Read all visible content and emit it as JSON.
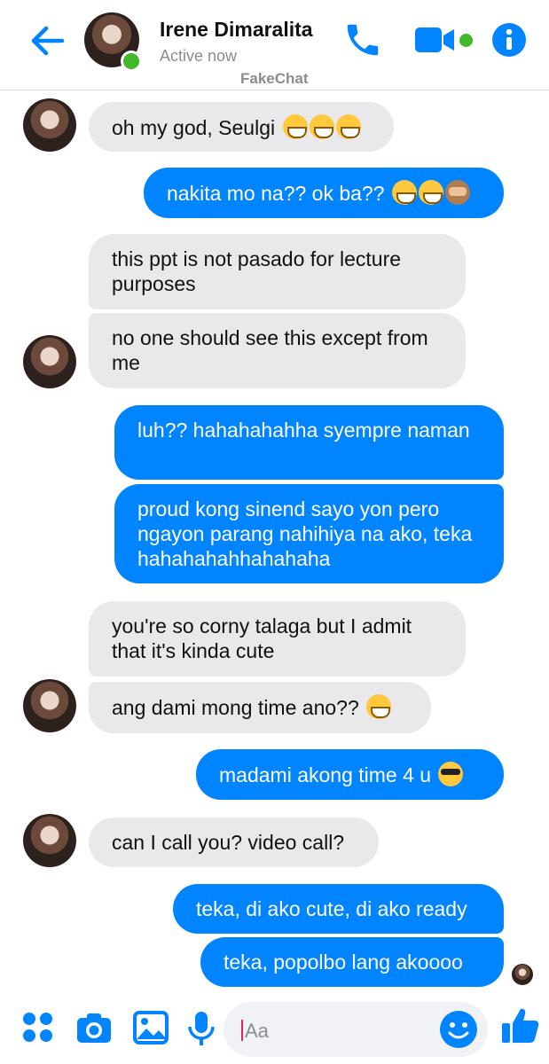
{
  "header": {
    "contact_name": "Irene Dimaralita",
    "status": "Active now",
    "watermark": "FakeChat"
  },
  "colors": {
    "accent": "#0084ff",
    "incoming_bubble": "#e9e9eb",
    "online": "#42b72a"
  },
  "messages": [
    {
      "side": "in",
      "text": "oh my god, Seulgi ",
      "emojis": [
        "grin",
        "grin",
        "grin"
      ]
    },
    {
      "side": "out",
      "text": "nakita mo na?? ok ba?? ",
      "emojis": [
        "grin",
        "grin",
        "see-no-evil-monkey"
      ]
    },
    {
      "side": "in",
      "text": "this ppt is not pasado for lecture purposes"
    },
    {
      "side": "in",
      "text": "no one should see this except from me"
    },
    {
      "side": "out",
      "text": "luh?? hahahahahha syempre naman"
    },
    {
      "side": "out",
      "text": "proud kong sinend sayo yon pero ngayon parang nahihiya na ako, teka hahahahahhahahaha"
    },
    {
      "side": "in",
      "text": "you're so corny talaga but I admit that it's kinda cute"
    },
    {
      "side": "in",
      "text": "ang dami mong time ano?? ",
      "emojis": [
        "grin"
      ]
    },
    {
      "side": "out",
      "text": "madami akong time 4 u ",
      "emojis": [
        "sunglasses"
      ]
    },
    {
      "side": "in",
      "text": "can I call you? video call?"
    },
    {
      "side": "out",
      "text": "teka, di ako cute, di ako ready"
    },
    {
      "side": "out",
      "text": "teka, popolbo lang akoooo"
    }
  ],
  "composer": {
    "placeholder": "Aa",
    "icons": [
      "menu-dots-icon",
      "camera-icon",
      "gallery-icon",
      "microphone-icon",
      "emoji-icon",
      "thumbs-up-icon"
    ]
  }
}
